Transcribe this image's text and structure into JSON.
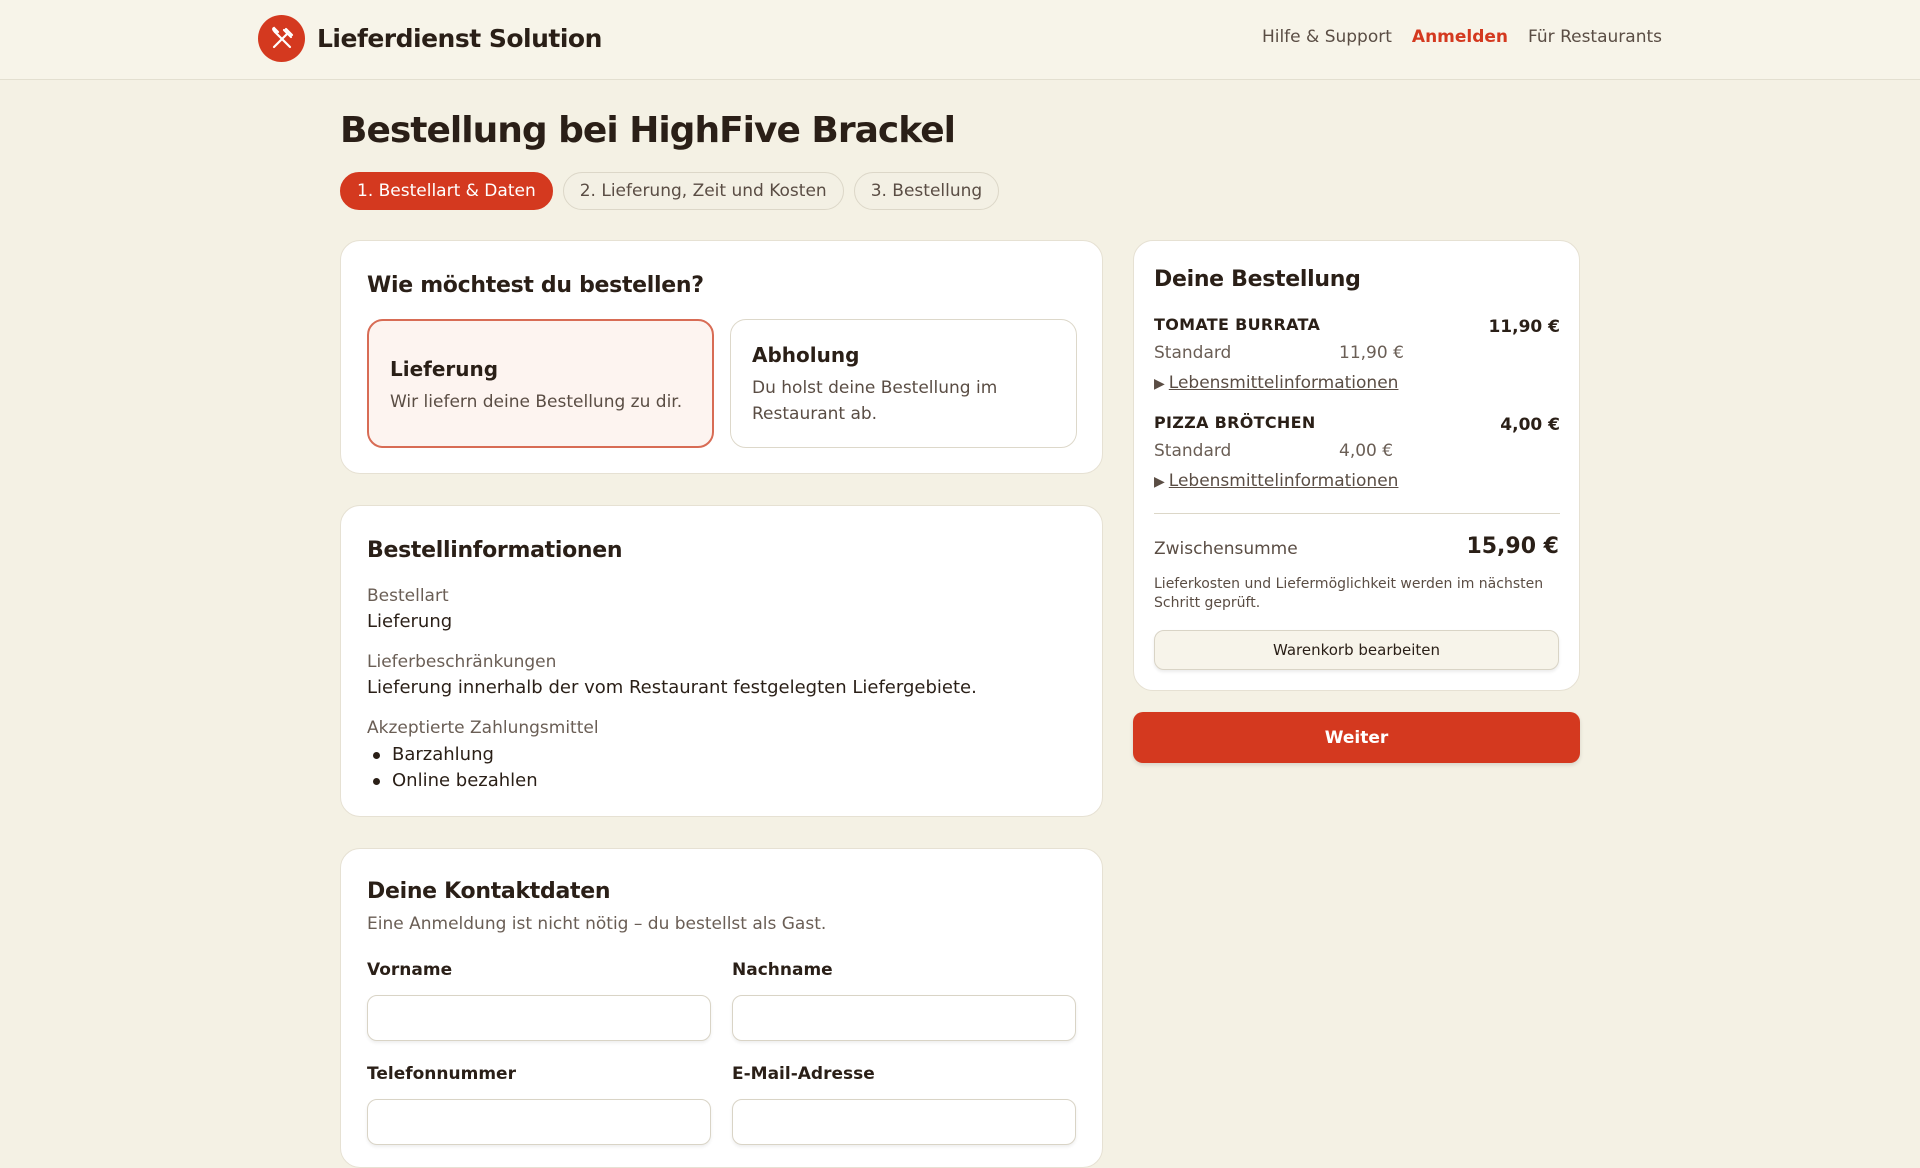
{
  "header": {
    "brand": "Lieferdienst Solution",
    "logo_icon": "fork-knife-icon",
    "nav": [
      {
        "label": "Hilfe & Support"
      },
      {
        "label": "Anmelden"
      },
      {
        "label": "Für Restaurants"
      }
    ]
  },
  "page": {
    "title": "Bestellung bei HighFive Brackel",
    "steps": [
      {
        "label": "1. Bestellart & Daten",
        "active": true
      },
      {
        "label": "2. Lieferung, Zeit und Kosten",
        "active": false
      },
      {
        "label": "3. Bestellung",
        "active": false
      }
    ]
  },
  "order_type": {
    "heading": "Wie möchtest du bestellen?",
    "options": [
      {
        "title": "Lieferung",
        "description": "Wir liefern deine Bestellung zu dir.",
        "selected": true
      },
      {
        "title": "Abholung",
        "description": "Du holst deine Bestellung im Restaurant ab.",
        "selected": false
      }
    ]
  },
  "order_info": {
    "heading": "Bestellinformationen",
    "order_type_label": "Bestellart",
    "order_type_value": "Lieferung",
    "restrictions_label": "Lieferbeschränkungen",
    "restrictions_value": "Lieferung innerhalb der vom Restaurant festgelegten Liefergebiete.",
    "payment_label": "Akzeptierte Zahlungsmittel",
    "payment_methods": [
      "Barzahlung",
      "Online bezahlen"
    ]
  },
  "contact": {
    "heading": "Deine Kontaktdaten",
    "subtitle": "Eine Anmeldung ist nicht nötig – du bestellst als Gast.",
    "fields": [
      {
        "label": "Vorname",
        "value": ""
      },
      {
        "label": "Nachname",
        "value": ""
      },
      {
        "label": "Telefonnummer",
        "value": ""
      },
      {
        "label": "E-Mail-Adresse",
        "value": ""
      }
    ]
  },
  "summary": {
    "heading": "Deine Bestellung",
    "items": [
      {
        "name": "TOMATE BURRATA",
        "price": "11,90 €",
        "variant": "Standard",
        "variant_price": "11,90 €",
        "info_link": "Lebensmittelinformationen"
      },
      {
        "name": "PIZZA BRÖTCHEN",
        "price": "4,00 €",
        "variant": "Standard",
        "variant_price": "4,00 €",
        "info_link": "Lebensmittelinformationen"
      }
    ],
    "subtotal_label": "Zwischensumme",
    "subtotal_value": "15,90 €",
    "note": "Lieferkosten und Liefermöglichkeit werden im nächsten Schritt geprüft.",
    "edit_cart_label": "Warenkorb bearbeiten",
    "next_label": "Weiter"
  },
  "colors": {
    "accent": "#d4391f",
    "background": "#f4f1e4",
    "text": "#2a1f17"
  }
}
